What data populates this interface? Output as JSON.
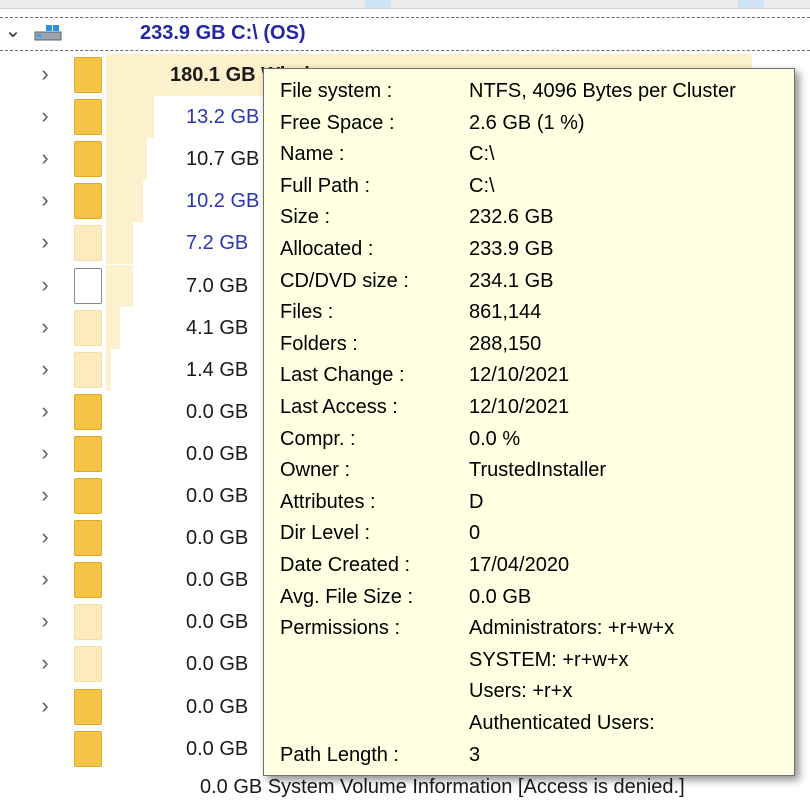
{
  "root": {
    "title": "233.9 GB  C:\\  (OS)",
    "icon": "drive-icon"
  },
  "rows": [
    {
      "size": "180.1 GB",
      "name": "Windows",
      "fill": 0.95,
      "folder": "full",
      "style": "bold"
    },
    {
      "size": "13.2 GB",
      "fill": 0.07,
      "folder": "full",
      "style": "blue"
    },
    {
      "size": "10.7 GB",
      "fill": 0.06,
      "folder": "full",
      "style": "normal"
    },
    {
      "size": "10.2 GB",
      "fill": 0.055,
      "folder": "full",
      "style": "blue"
    },
    {
      "size": "7.2 GB",
      "fill": 0.04,
      "folder": "pale",
      "style": "blue"
    },
    {
      "size": "7.0 GB",
      "fill": 0.04,
      "folder": "file",
      "style": "normal"
    },
    {
      "size": "4.1 GB",
      "fill": 0.02,
      "folder": "pale",
      "style": "normal"
    },
    {
      "size": "1.4 GB",
      "fill": 0.008,
      "folder": "pale",
      "style": "normal"
    },
    {
      "size": "0.0 GB",
      "fill": 0,
      "folder": "full",
      "style": "normal"
    },
    {
      "size": "0.0 GB",
      "fill": 0,
      "folder": "full",
      "style": "normal"
    },
    {
      "size": "0.0 GB",
      "fill": 0,
      "folder": "full",
      "style": "normal"
    },
    {
      "size": "0.0 GB",
      "fill": 0,
      "folder": "full",
      "style": "normal"
    },
    {
      "size": "0.0 GB",
      "fill": 0,
      "folder": "full",
      "style": "normal"
    },
    {
      "size": "0.0 GB",
      "fill": 0,
      "folder": "pale",
      "style": "normal"
    },
    {
      "size": "0.0 GB",
      "fill": 0,
      "folder": "pale",
      "style": "normal"
    },
    {
      "size": "0.0 GB",
      "fill": 0,
      "folder": "full",
      "style": "normal"
    },
    {
      "size": "0.0 GB",
      "fill": 0,
      "folder": "full",
      "style": "normal"
    }
  ],
  "bottom_row_text": "0.0 GB  System Volume Information  [Access is denied.]",
  "tooltip": {
    "fields": [
      {
        "label": "File system :",
        "value": "NTFS, 4096 Bytes per Cluster"
      },
      {
        "label": "Free Space :",
        "value": "2.6 GB  (1 %)"
      },
      {
        "label": "Name :",
        "value": "C:\\"
      },
      {
        "label": "Full Path :",
        "value": "C:\\"
      },
      {
        "label": "Size :",
        "value": "232.6 GB"
      },
      {
        "label": "Allocated :",
        "value": "233.9 GB"
      },
      {
        "label": "CD/DVD size :",
        "value": "234.1 GB"
      },
      {
        "label": "Files :",
        "value": "861,144"
      },
      {
        "label": "Folders :",
        "value": "288,150"
      },
      {
        "label": "Last Change :",
        "value": "12/10/2021"
      },
      {
        "label": "Last Access :",
        "value": "12/10/2021"
      },
      {
        "label": "Compr. :",
        "value": "0.0 %"
      },
      {
        "label": "Owner :",
        "value": "TrustedInstaller"
      },
      {
        "label": "Attributes :",
        "value": "D"
      },
      {
        "label": "Dir Level :",
        "value": "0"
      },
      {
        "label": "Date Created :",
        "value": "17/04/2020"
      },
      {
        "label": "Avg. File Size :",
        "value": "0.0 GB"
      },
      {
        "label": "Permissions :",
        "value": "Administrators: +r+w+x"
      },
      {
        "label": "",
        "value": "SYSTEM: +r+w+x"
      },
      {
        "label": "",
        "value": "Users: +r+x"
      },
      {
        "label": "",
        "value": "Authenticated Users:"
      },
      {
        "label": "Path Length :",
        "value": "3"
      }
    ]
  },
  "colors": {
    "tooltip_bg": "#ffffe1",
    "bar_fill": "#fdf0c8",
    "blue_text": "#2b35b5",
    "folder": "#f5c444"
  }
}
